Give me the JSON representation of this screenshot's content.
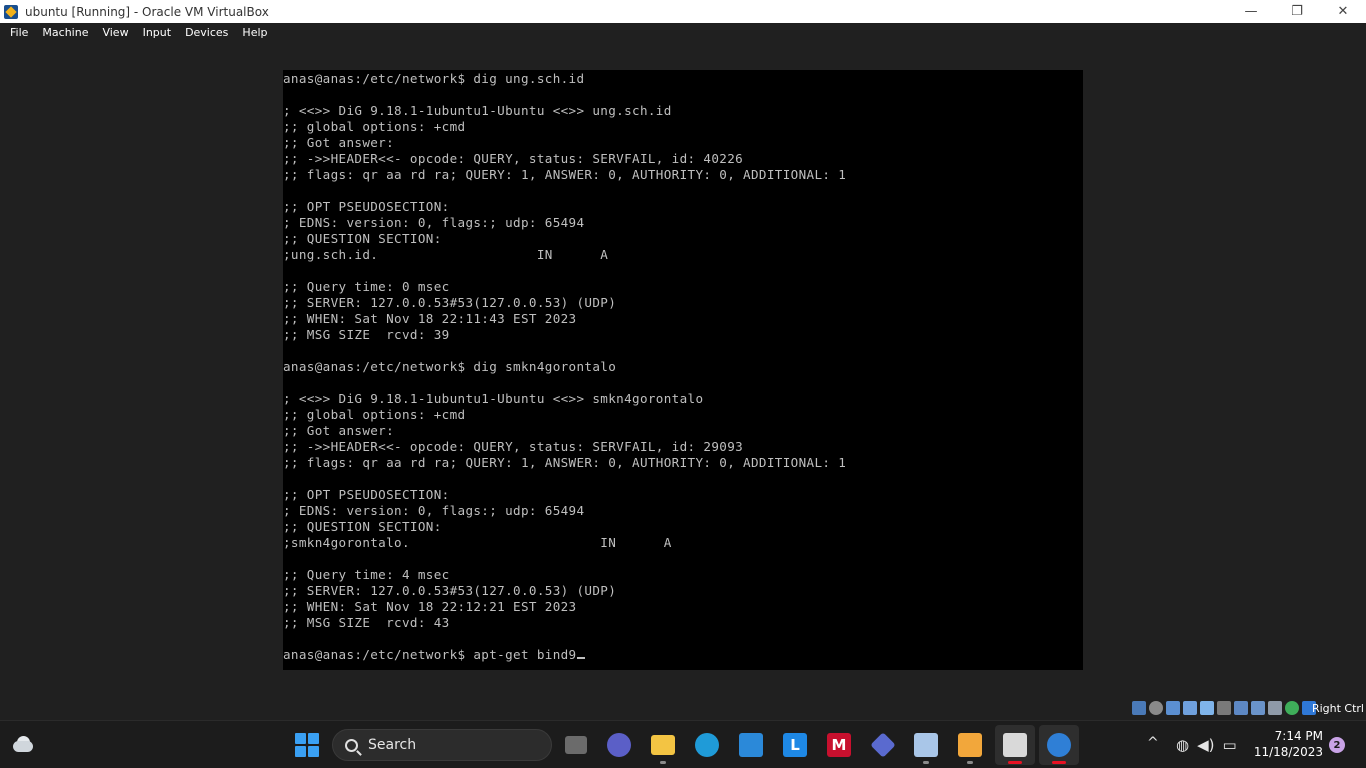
{
  "window": {
    "title": "ubuntu [Running] - Oracle VM VirtualBox",
    "minimize": "—",
    "maximize": "❐",
    "close": "✕"
  },
  "menu": {
    "file": "File",
    "machine": "Machine",
    "view": "View",
    "input": "Input",
    "devices": "Devices",
    "help": "Help"
  },
  "terminal": {
    "output": "anas@anas:/etc/network$ dig ung.sch.id\n\n; <<>> DiG 9.18.1-1ubuntu1-Ubuntu <<>> ung.sch.id\n;; global options: +cmd\n;; Got answer:\n;; ->>HEADER<<- opcode: QUERY, status: SERVFAIL, id: 40226\n;; flags: qr aa rd ra; QUERY: 1, ANSWER: 0, AUTHORITY: 0, ADDITIONAL: 1\n\n;; OPT PSEUDOSECTION:\n; EDNS: version: 0, flags:; udp: 65494\n;; QUESTION SECTION:\n;ung.sch.id.                    IN      A\n\n;; Query time: 0 msec\n;; SERVER: 127.0.0.53#53(127.0.0.53) (UDP)\n;; WHEN: Sat Nov 18 22:11:43 EST 2023\n;; MSG SIZE  rcvd: 39\n\nanas@anas:/etc/network$ dig smkn4gorontalo\n\n; <<>> DiG 9.18.1-1ubuntu1-Ubuntu <<>> smkn4gorontalo\n;; global options: +cmd\n;; Got answer:\n;; ->>HEADER<<- opcode: QUERY, status: SERVFAIL, id: 29093\n;; flags: qr aa rd ra; QUERY: 1, ANSWER: 0, AUTHORITY: 0, ADDITIONAL: 1\n\n;; OPT PSEUDOSECTION:\n; EDNS: version: 0, flags:; udp: 65494\n;; QUESTION SECTION:\n;smkn4gorontalo.                        IN      A\n\n;; Query time: 4 msec\n;; SERVER: 127.0.0.53#53(127.0.0.53) (UDP)\n;; WHEN: Sat Nov 18 22:12:21 EST 2023\n;; MSG SIZE  rcvd: 43\n\n",
    "current_line": "anas@anas:/etc/network$ apt-get bind9"
  },
  "status_bar": {
    "host_key": "Right Ctrl",
    "icons": [
      "hard-disk-icon",
      "optical-drive-icon",
      "audio-icon",
      "network-icon",
      "usb-icon",
      "shared-folders-icon",
      "display-icon",
      "video-capture-icon",
      "cpu-icon",
      "mouse-integration-icon",
      "keyboard-icon"
    ]
  },
  "taskbar": {
    "search_label": "Search",
    "apps": [
      "file-explorer-icon",
      "meet-icon",
      "folder-icon",
      "edge-icon",
      "store-icon",
      "l-app-icon",
      "mcafee-icon",
      "vpn-icon",
      "virtualbox-icon",
      "paint-icon",
      "snipping-tool-icon",
      "active-vm-icon"
    ],
    "time": "7:14 PM",
    "date": "11/18/2023",
    "notification_count": "2"
  },
  "colors": {
    "terminal_bg": "#000000",
    "terminal_fg": "#bfbfbf",
    "chrome_bg": "#202020",
    "taskbar_bg": "#1c1c1c",
    "accent_blue": "#3aa0f3"
  }
}
